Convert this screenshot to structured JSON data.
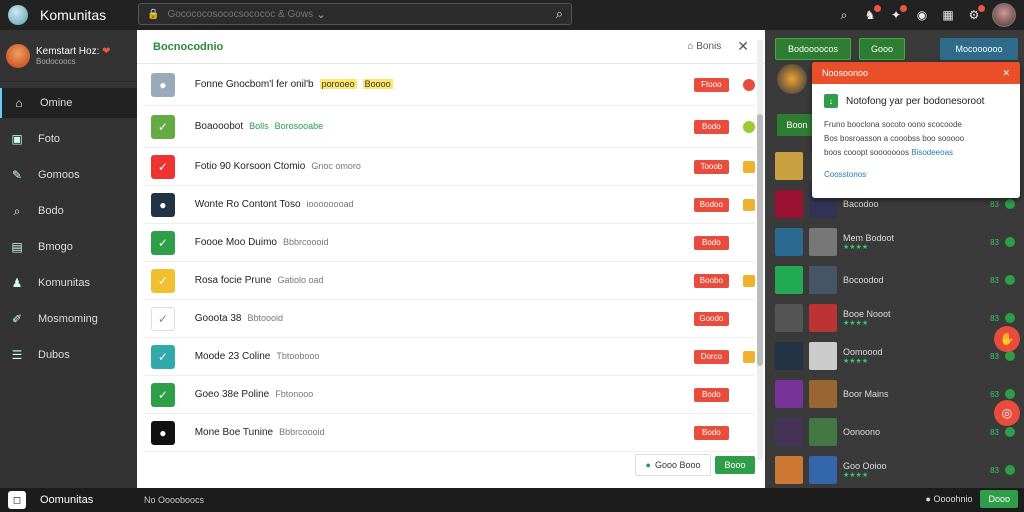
{
  "app": {
    "name": "Komunitas"
  },
  "search": {
    "placeholder": "Gocococosococsocococ & Gows"
  },
  "profile": {
    "name": "Kemstart Hoz:",
    "sub": "Bodocoocs"
  },
  "sidebar": {
    "items": [
      {
        "label": "Omine",
        "icon": "home-icon",
        "glyph": "⌂"
      },
      {
        "label": "Foto",
        "icon": "image-icon",
        "glyph": "▣"
      },
      {
        "label": "Gomoos",
        "icon": "pen-icon",
        "glyph": "✎"
      },
      {
        "label": "Bodo",
        "icon": "search-icon",
        "glyph": "⌕"
      },
      {
        "label": "Bmogo",
        "icon": "folder-icon",
        "glyph": "▤"
      },
      {
        "label": "Komunitas",
        "icon": "people-icon",
        "glyph": "♟"
      },
      {
        "label": "Mosmoming",
        "icon": "brush-icon",
        "glyph": "✐"
      },
      {
        "label": "Dubos",
        "icon": "list-icon",
        "glyph": "☰"
      }
    ]
  },
  "main": {
    "title": "Bocnocodnio",
    "options_label": "Bonis",
    "rows": [
      {
        "text": "Fonne Gnocbom'l fer onil'b",
        "tag": "porooeo",
        "tag2": "Boooo",
        "btn": "Ftooo",
        "mark": "#e74c3c",
        "iconbg": "#9ab"
      },
      {
        "text": "Boaooobot",
        "tag": "Bolls",
        "tag2": "Borosooabe",
        "btn": "Bodo",
        "mark": "#9c3",
        "iconbg": "#6a4"
      },
      {
        "text": "Fotio 90 Korsoon  Ctomio",
        "tag": "Gnoc omoro",
        "tag2": "",
        "btn": "Tooob",
        "mark": "#f0b030",
        "iconbg": "#e33"
      },
      {
        "text": "Wonte Ro Contont  Toso",
        "tag": "ioooooooad",
        "tag2": "",
        "btn": "Bodoo",
        "mark": "#f0b030",
        "iconbg": "#234"
      },
      {
        "text": "Foooe Moo  Duimo",
        "tag": "Bbbrcoooid",
        "tag2": "",
        "btn": "Bodo",
        "mark": "",
        "iconbg": "#2e9e4a"
      },
      {
        "text": "Rosa focie  Prune",
        "tag": "Gatiolo oad",
        "tag2": "",
        "btn": "Boobo",
        "mark": "#f0b030",
        "iconbg": "#f0c030"
      },
      {
        "text": "Gooota 38",
        "tag": "Bbtoooid",
        "tag2": "",
        "btn": "Goodo",
        "mark": "",
        "iconbg": "#fff"
      },
      {
        "text": "Moode 23  Coline",
        "tag": "Tbtoobooo",
        "tag2": "",
        "btn": "Dorco",
        "mark": "#f0b030",
        "iconbg": "#3aa"
      },
      {
        "text": "Goeo 38e  Poline",
        "tag": "Fbtonooo",
        "tag2": "",
        "btn": "Bodo",
        "mark": "",
        "iconbg": "#2e9e4a"
      },
      {
        "text": "Mone Boe  Tunine",
        "tag": "Bbbrcoooid",
        "tag2": "",
        "btn": "Bodo",
        "mark": "",
        "iconbg": "#111"
      }
    ],
    "footer": {
      "secondary": "Gooo Booo",
      "primary": "Booo"
    }
  },
  "right": {
    "buttons": [
      {
        "label": "Bodoooocos"
      },
      {
        "label": "Gooo"
      },
      {
        "label": "Mocoooooo"
      }
    ],
    "section_label": "Boon",
    "list": [
      {
        "name": "",
        "rating": "",
        "num": "",
        "c1": "#c8a040",
        "c2": "#444"
      },
      {
        "name": "Bacodoo",
        "rating": "",
        "num": "83",
        "c1": "#913",
        "c2": "#335"
      },
      {
        "name": "Mem Bodoot",
        "rating": "★★★★",
        "num": "83",
        "c1": "#2a6a90",
        "c2": "#777"
      },
      {
        "name": "Bocoodod",
        "rating": "",
        "num": "83",
        "c1": "#2a5",
        "c2": "#456"
      },
      {
        "name": "Booe Nooot",
        "rating": "★★★★",
        "num": "83",
        "c1": "#555",
        "c2": "#b33"
      },
      {
        "name": "Oomoood",
        "rating": "★★★★",
        "num": "83",
        "c1": "#234",
        "c2": "#ccc"
      },
      {
        "name": "Boor Mains",
        "rating": "",
        "num": "63",
        "c1": "#739",
        "c2": "#963"
      },
      {
        "name": "Oonoono",
        "rating": "",
        "num": "83",
        "c1": "#435",
        "c2": "#474"
      },
      {
        "name": "Goo Ooioo",
        "rating": "★★★★",
        "num": "83",
        "c1": "#c73",
        "c2": "#36a"
      }
    ]
  },
  "popup": {
    "title": "Noosoonoo",
    "heading": "Notofong yar per bodonesoroot",
    "desc1": "Fruno booclona  socoto oono scocoode",
    "desc2": "Bos bosroasson a  cooobss boo sooooo",
    "desc3": "boos cooopt sooooooos",
    "link": "Bisodeeoas",
    "more": "Coosstonos"
  },
  "bottom": {
    "name": "Oomunitas",
    "status": "No Ooooboocs",
    "right_label": "Oooohnio",
    "right_button": "Dooo"
  },
  "colors": {
    "accent": "#2e9e4a",
    "danger": "#e74c3c",
    "popup_header": "#e9502a"
  }
}
